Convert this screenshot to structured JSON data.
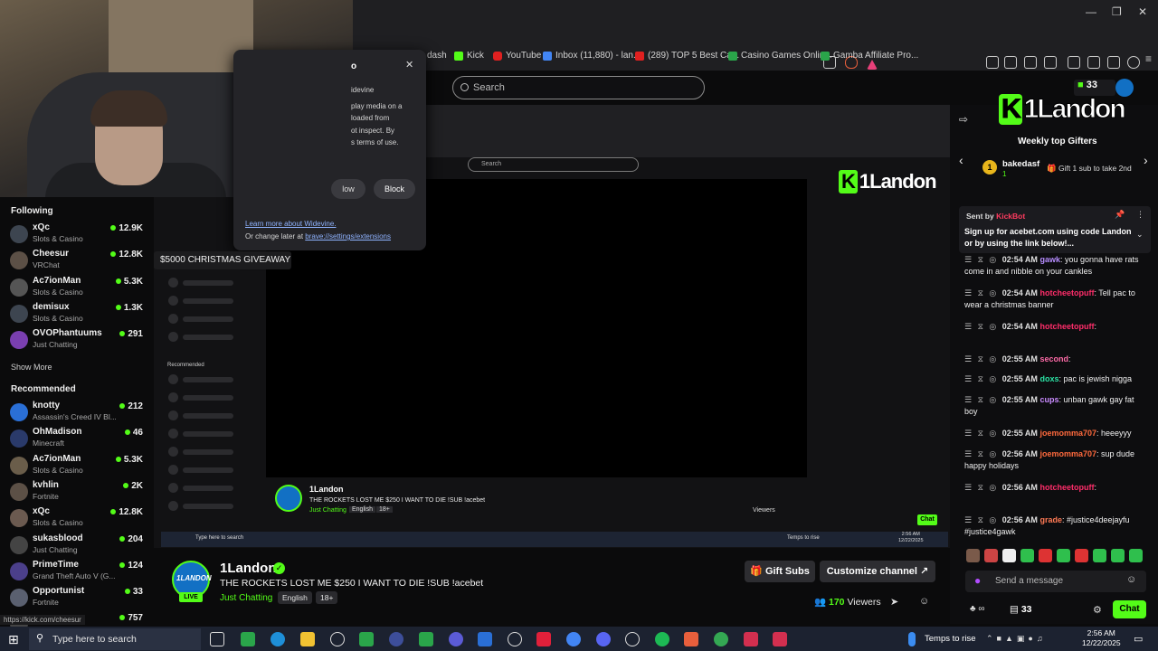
{
  "browser": {
    "bookmarks": [
      "dash",
      "Kick",
      "YouTube",
      "Inbox (11,880) - lan...",
      "(289) TOP 5 Best Ca...",
      "Casino Games Onlin...",
      "Gamba Affiliate Pro..."
    ],
    "search_placeholder": "Search"
  },
  "popup": {
    "title_fragment": "o",
    "line1": "idevine",
    "line2": "play media on a",
    "line3": "loaded from",
    "line4": "ot inspect. By",
    "line5": "s terms of use.",
    "allow_label": "low",
    "block_label": "Block",
    "learn_more": "Learn more about Widevine.",
    "change_later_prefix": "Or change later at ",
    "change_later_link": "brave://settings/extensions"
  },
  "sidebar": {
    "following_title": "Following",
    "following": [
      {
        "name": "xQc",
        "category": "Slots & Casino",
        "viewers": "12.9K"
      },
      {
        "name": "Cheesur",
        "category": "VRChat",
        "viewers": "12.8K"
      },
      {
        "name": "Ac7ionMan",
        "category": "Slots & Casino",
        "viewers": "5.3K"
      },
      {
        "name": "demisux",
        "category": "Slots & Casino",
        "viewers": "1.3K"
      },
      {
        "name": "OVOPhantuums",
        "category": "Just Chatting",
        "viewers": "291"
      }
    ],
    "show_more": "Show More",
    "recommended_title": "Recommended",
    "recommended": [
      {
        "name": "knotty",
        "category": "Assassin's Creed IV Bl...",
        "viewers": "212"
      },
      {
        "name": "OhMadison",
        "category": "Minecraft",
        "viewers": "46"
      },
      {
        "name": "Ac7ionMan",
        "category": "Slots & Casino",
        "viewers": "5.3K"
      },
      {
        "name": "kvhlin",
        "category": "Fortnite",
        "viewers": "2K"
      },
      {
        "name": "xQc",
        "category": "Slots & Casino",
        "viewers": "12.8K"
      },
      {
        "name": "sukasblood",
        "category": "Just Chatting",
        "viewers": "204"
      },
      {
        "name": "PrimeTime",
        "category": "Grand Theft Auto V (G...",
        "viewers": "124"
      },
      {
        "name": "Opportunist",
        "category": "Fortnite",
        "viewers": "33"
      },
      {
        "name": "",
        "category": "",
        "viewers": "757"
      }
    ],
    "status_url": "https://kick.com/cheesur"
  },
  "tooltip": "$5000 CHRISTMAS GIVEAWAY",
  "inner": {
    "search": "Search",
    "logo": "1Landon",
    "channel": "1Landon",
    "title": "THE ROCKETS LOST ME $250 I WANT TO DIE !SUB !acebet",
    "category": "Just Chatting",
    "tags": [
      "English",
      "18+"
    ],
    "recommended": "Recommended",
    "viewers_label": "Viewers",
    "chat_button": "Chat",
    "taskbar_search": "Type here to search",
    "weather": "Temps to rise",
    "time": "2:56 AM",
    "date": "12/22/2025"
  },
  "stream": {
    "avatar_text": "1LANDON",
    "live_badge": "LIVE",
    "channel_name": "1Landon",
    "title": "THE ROCKETS LOST ME $250 I WANT TO DIE !SUB !acebet",
    "category": "Just Chatting",
    "tags": [
      "English",
      "18+"
    ],
    "gift_subs": "Gift Subs",
    "customize": "Customize channel",
    "viewer_count": "170",
    "viewers_label": "Viewers"
  },
  "chat": {
    "sub_count": "33",
    "logo": "1Landon",
    "weekly_title": "Weekly top Gifters",
    "top_gifter": {
      "rank": "1",
      "name": "bakedasf",
      "subs": "1",
      "cta": "Gift 1 sub to take 2nd"
    },
    "pinned": {
      "sent_by": "Sent by",
      "bot": "KickBot",
      "text": "Sign up for acebet.com using code Landon or by using the link below!..."
    },
    "messages": [
      {
        "time": "02:54 AM",
        "user": "gawk",
        "color": "#b78dff",
        "text": "you gonna have rats come in and nibble on your cankles"
      },
      {
        "time": "02:54 AM",
        "user": "hotcheetopuff",
        "color": "#ff2d6a",
        "text": "Tell pac to wear a christmas banner"
      },
      {
        "time": "02:54 AM",
        "user": "hotcheetopuff",
        "color": "#ff2d6a",
        "text": ""
      },
      {
        "time": "02:55 AM",
        "user": "second",
        "color": "#ff6ba8",
        "text": ""
      },
      {
        "time": "02:55 AM",
        "user": "doxs",
        "color": "#2be2a4",
        "text": "pac is jewish nigga"
      },
      {
        "time": "02:55 AM",
        "user": "cups",
        "color": "#c98bff",
        "text": "unban gawk gay fat boy"
      },
      {
        "time": "02:55 AM",
        "user": "joemomma707",
        "color": "#ff6a3d",
        "text": "heeeyyy"
      },
      {
        "time": "02:56 AM",
        "user": "joemomma707",
        "color": "#ff6a3d",
        "text": "sup dude happy holidays"
      },
      {
        "time": "02:56 AM",
        "user": "hotcheetopuff",
        "color": "#ff2d6a",
        "text": ""
      },
      {
        "time": "02:56 AM",
        "user": "grade",
        "color": "#ff7a55",
        "text": "#justice4deejayfu #justice4gawk"
      }
    ],
    "input_placeholder": "Send a message",
    "footer_count": "33",
    "chat_button": "Chat"
  },
  "taskbar": {
    "search_placeholder": "Type here to search",
    "weather": "Temps to rise",
    "time": "2:56 AM",
    "date": "12/22/2025"
  },
  "colors": {
    "accent": "#53fc18",
    "background": "#0b0b0c",
    "panel": "#1d1d20"
  }
}
